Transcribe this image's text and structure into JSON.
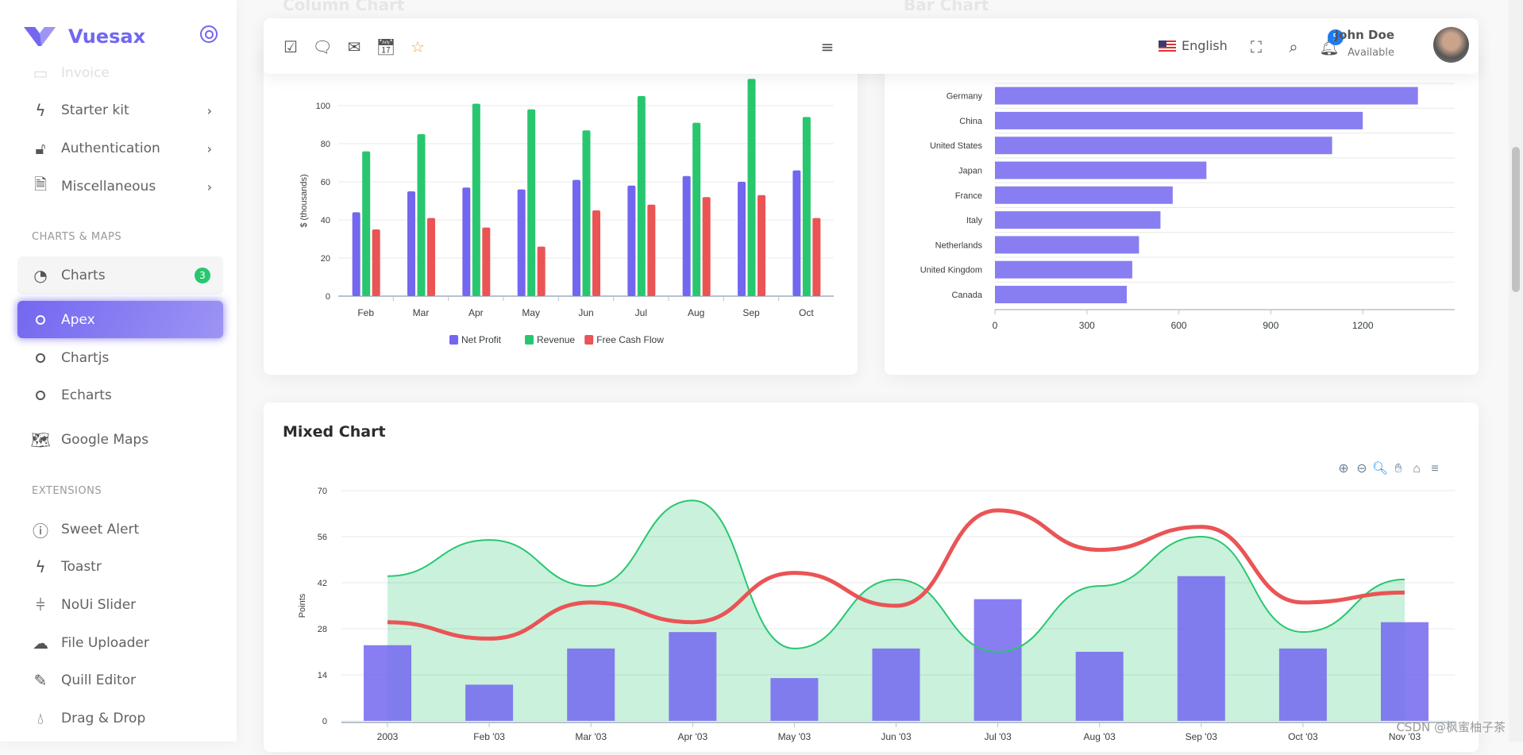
{
  "brand": {
    "name": "Vuesax",
    "accent": "#7367f0"
  },
  "sidebar": {
    "items_top": [
      {
        "label": "Invoice",
        "icon": "file-icon"
      },
      {
        "label": "Starter kit",
        "icon": "zap-icon"
      },
      {
        "label": "Authentication",
        "icon": "unlock-icon"
      },
      {
        "label": "Miscellaneous",
        "icon": "file-text-icon"
      }
    ],
    "section_charts": "CHARTS & MAPS",
    "charts": {
      "label": "Charts",
      "badge": "3"
    },
    "chart_sub": [
      {
        "label": "Apex"
      },
      {
        "label": "Chartjs"
      },
      {
        "label": "Echarts"
      }
    ],
    "maps": {
      "label": "Google Maps"
    },
    "section_ext": "EXTENSIONS",
    "extensions": [
      {
        "label": "Sweet Alert"
      },
      {
        "label": "Toastr"
      },
      {
        "label": "NoUi Slider"
      },
      {
        "label": "File Uploader"
      },
      {
        "label": "Quill Editor"
      },
      {
        "label": "Drag & Drop"
      }
    ]
  },
  "navbar": {
    "language": "English",
    "notifications": "5",
    "user_name": "John Doe",
    "user_status": "Available"
  },
  "cards": {
    "column_title": "Column Chart",
    "bar_title": "Bar Chart",
    "mixed_title": "Mixed Chart"
  },
  "watermark": "CSDN @枫蜜柚子茶",
  "chart_data": [
    {
      "type": "bar",
      "title": "Column Chart",
      "categories": [
        "Feb",
        "Mar",
        "Apr",
        "May",
        "Jun",
        "Jul",
        "Aug",
        "Sep",
        "Oct"
      ],
      "ylabel": "$ (thousands)",
      "ylim": [
        0,
        110
      ],
      "yticks": [
        0,
        20,
        40,
        60,
        80,
        100
      ],
      "legend": "bottom",
      "series": [
        {
          "name": "Net Profit",
          "color": "#7367f0",
          "values": [
            44,
            55,
            57,
            56,
            61,
            58,
            63,
            60,
            66
          ]
        },
        {
          "name": "Revenue",
          "color": "#28c76f",
          "values": [
            76,
            85,
            101,
            98,
            87,
            105,
            91,
            114,
            94
          ]
        },
        {
          "name": "Free Cash Flow",
          "color": "#ea5455",
          "values": [
            35,
            41,
            36,
            26,
            45,
            48,
            52,
            53,
            41
          ]
        }
      ]
    },
    {
      "type": "bar",
      "orientation": "horizontal",
      "title": "Bar Chart",
      "categories": [
        "Canada",
        "United Kingdom",
        "Netherlands",
        "Italy",
        "France",
        "Japan",
        "United States",
        "China",
        "Germany"
      ],
      "values": [
        430,
        448,
        470,
        540,
        580,
        690,
        1100,
        1200,
        1380
      ],
      "xlim": [
        0,
        1500
      ],
      "xticks": [
        0,
        300,
        600,
        900,
        1200
      ],
      "color": "#7367f0"
    },
    {
      "type": "mixed",
      "title": "Mixed Chart",
      "categories": [
        "2003",
        "Feb '03",
        "Mar '03",
        "Apr '03",
        "May '03",
        "Jun '03",
        "Jul '03",
        "Aug '03",
        "Sep '03",
        "Oct '03",
        "Nov '03"
      ],
      "ylabel": "Points",
      "ylim": [
        0,
        70
      ],
      "yticks": [
        0,
        14,
        28,
        42,
        56,
        70
      ],
      "series": [
        {
          "type": "column",
          "color": "#7367f0",
          "values": [
            23,
            11,
            22,
            27,
            13,
            22,
            37,
            21,
            44,
            22,
            30
          ]
        },
        {
          "type": "area",
          "color": "#28c76f",
          "values": [
            44,
            55,
            41,
            67,
            22,
            43,
            21,
            41,
            56,
            27,
            43
          ]
        },
        {
          "type": "line",
          "color": "#ea5455",
          "values": [
            30,
            25,
            36,
            30,
            45,
            35,
            64,
            52,
            59,
            36,
            39
          ]
        }
      ],
      "toolbar": [
        "zoom-in-icon",
        "zoom-out-icon",
        "selection-zoom-icon",
        "pan-icon",
        "home-icon",
        "menu-icon"
      ]
    }
  ]
}
